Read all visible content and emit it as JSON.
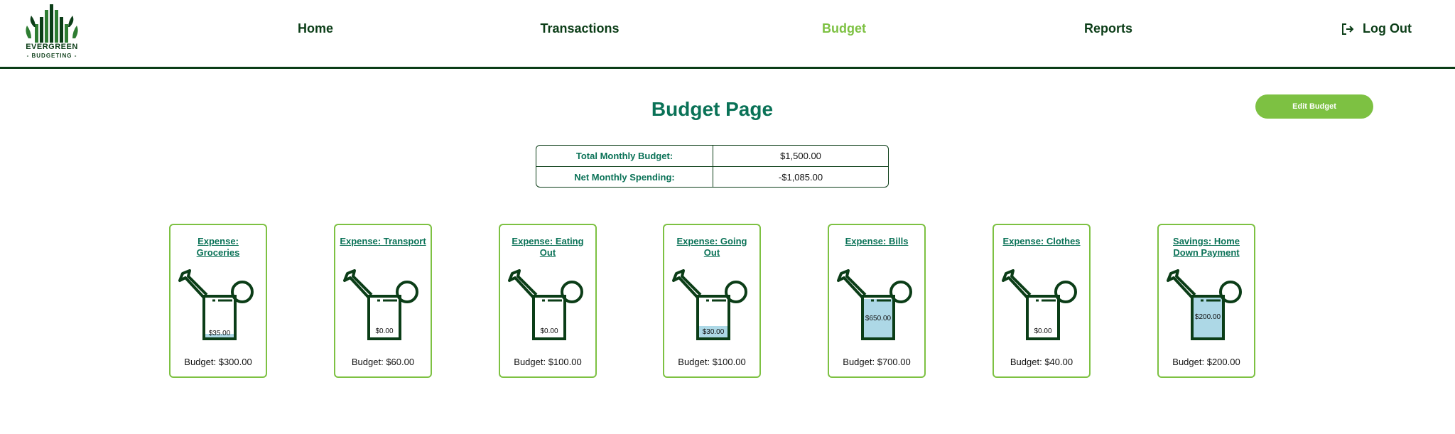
{
  "logo": {
    "line1": "EVERGREEN",
    "line2": "- BUDGETING -"
  },
  "nav": [
    {
      "label": "Home",
      "active": false
    },
    {
      "label": "Transactions",
      "active": false
    },
    {
      "label": "Budget",
      "active": true
    },
    {
      "label": "Reports",
      "active": false
    }
  ],
  "logout": {
    "label": "Log Out",
    "icon": "logout-icon"
  },
  "page": {
    "title": "Budget Page",
    "edit_button": "Edit Budget"
  },
  "summary": [
    {
      "label": "Total Monthly Budget:",
      "value": "$1,500.00"
    },
    {
      "label": "Net Monthly Spending:",
      "value": "-$1,085.00"
    }
  ],
  "cards": [
    {
      "title": "Expense: Groceries",
      "amount": "$35.00",
      "fill": 0.117,
      "budget": "Budget: $300.00"
    },
    {
      "title": "Expense: Transport",
      "amount": "$0.00",
      "fill": 0,
      "budget": "Budget: $60.00"
    },
    {
      "title": "Expense: Eating Out",
      "amount": "$0.00",
      "fill": 0,
      "budget": "Budget: $100.00"
    },
    {
      "title": "Expense: Going Out",
      "amount": "$30.00",
      "fill": 0.3,
      "budget": "Budget: $100.00"
    },
    {
      "title": "Expense: Bills",
      "amount": "$650.00",
      "fill": 0.929,
      "budget": "Budget: $700.00"
    },
    {
      "title": "Expense: Clothes",
      "amount": "$0.00",
      "fill": 0,
      "budget": "Budget: $40.00"
    },
    {
      "title": "Savings: Home Down Payment",
      "amount": "$200.00",
      "fill": 1.0,
      "budget": "Budget: $200.00"
    }
  ],
  "colors": {
    "dark_green": "#0b3d17",
    "accent_green": "#7dc142",
    "teal": "#0a7257",
    "water": "#add8e6"
  }
}
